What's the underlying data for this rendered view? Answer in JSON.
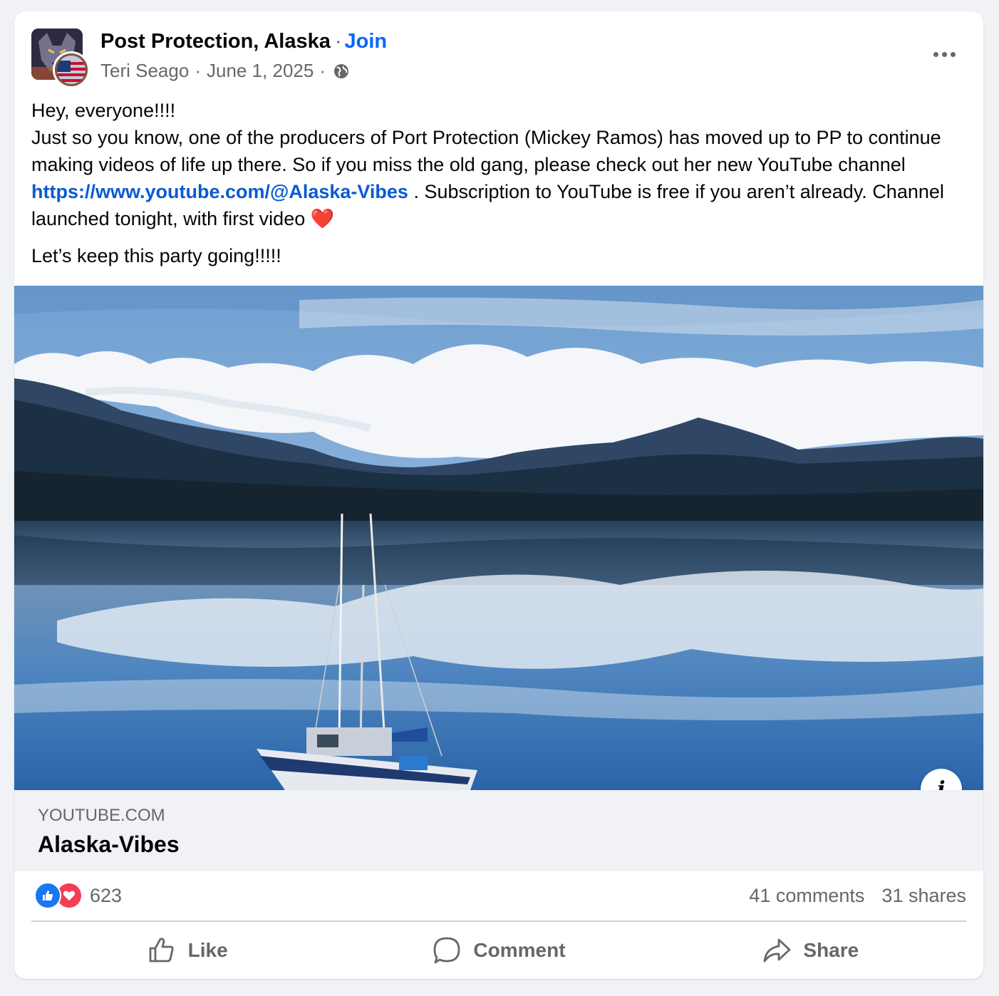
{
  "post": {
    "group_name": "Post Protection, Alaska",
    "join_label": "Join",
    "author": "Teri Seago",
    "date": "June 1, 2025",
    "separator": "·",
    "body": {
      "line1": "Hey, everyone!!!!",
      "line2_before_link": "Just so you know, one of the producers of Port Protection (Mickey Ramos) has moved up to PP to continue making videos of life up there. So if you miss the old gang, please check out her new YouTube channel ",
      "link": "https://www.youtube.com/@Alaska-Vibes",
      "line2_after_link": " . Subscription to YouTube is free if you aren’t already. Channel launched tonight, with first video ",
      "heart": "❤️",
      "closing": "Let’s keep this party going!!!!!"
    }
  },
  "link_preview": {
    "domain": "YOUTUBE.COM",
    "title": "Alaska-Vibes",
    "info_label": "i"
  },
  "stats": {
    "reaction_count": "623",
    "comments": "41 comments",
    "shares": "31 shares"
  },
  "actions": {
    "like": "Like",
    "comment": "Comment",
    "share": "Share"
  },
  "colors": {
    "accent": "#0866ff",
    "link": "#0a5ad4",
    "secondary_text": "#65676b",
    "like_reaction": "#1877f2",
    "love_reaction": "#f33e58",
    "page_bg": "#f0f2f5"
  }
}
